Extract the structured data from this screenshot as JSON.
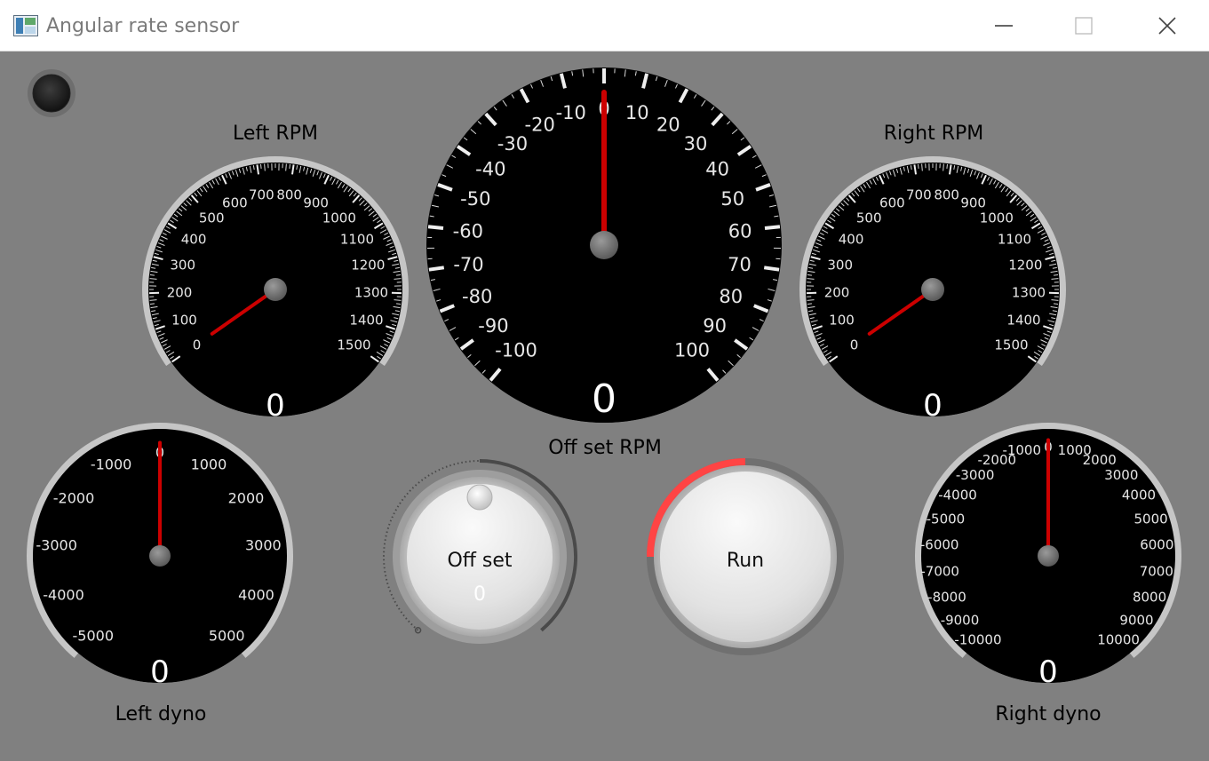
{
  "window": {
    "title": "Angular rate sensor",
    "icons": {
      "app": "app-window-icon",
      "minimize": "minimize-icon",
      "maximize": "maximize-icon",
      "close": "close-icon"
    }
  },
  "status_led": {
    "icon": "status-led-icon",
    "state": "off"
  },
  "gauges": {
    "left_rpm": {
      "label": "Left RPM",
      "readout": "0",
      "value": 0,
      "tick_labels": [
        "0",
        "100",
        "200",
        "300",
        "400",
        "500",
        "600",
        "700",
        "800",
        "900",
        "1000",
        "1100",
        "1200",
        "1300",
        "1400",
        "1500"
      ]
    },
    "offset_rpm": {
      "label": "Off set RPM",
      "readout": "0",
      "value": 0,
      "tick_labels": [
        "-100",
        "-90",
        "-80",
        "-70",
        "-60",
        "-50",
        "-40",
        "-30",
        "-20",
        "-10",
        "0",
        "10",
        "20",
        "30",
        "40",
        "50",
        "60",
        "70",
        "80",
        "90",
        "100"
      ]
    },
    "right_rpm": {
      "label": "Right RPM",
      "readout": "0",
      "value": 0,
      "tick_labels": [
        "0",
        "100",
        "200",
        "300",
        "400",
        "500",
        "600",
        "700",
        "800",
        "900",
        "1000",
        "1100",
        "1200",
        "1300",
        "1400",
        "1500"
      ]
    },
    "left_dyno": {
      "label": "Left dyno",
      "readout": "0",
      "value": 0,
      "tick_labels": [
        "-5000",
        "-4000",
        "-3000",
        "-2000",
        "-1000",
        "0",
        "1000",
        "2000",
        "3000",
        "4000",
        "5000"
      ]
    },
    "right_dyno": {
      "label": "Right dyno",
      "readout": "0",
      "value": 0,
      "tick_labels": [
        "-10000",
        "-9000",
        "-8000",
        "-7000",
        "-6000",
        "-5000",
        "-4000",
        "-3000",
        "-2000",
        "-1000",
        "0",
        "1000",
        "2000",
        "3000",
        "4000",
        "5000",
        "6000",
        "7000",
        "8000",
        "9000",
        "10000"
      ]
    }
  },
  "offset_knob": {
    "label": "Off set",
    "value_text": "0",
    "value": 0
  },
  "run_button": {
    "label": "Run",
    "progress": 0.25
  },
  "colors": {
    "background": "#808080",
    "needle": "#cc0000",
    "dial_face": "#000000",
    "run_arc": "#ff4444"
  }
}
